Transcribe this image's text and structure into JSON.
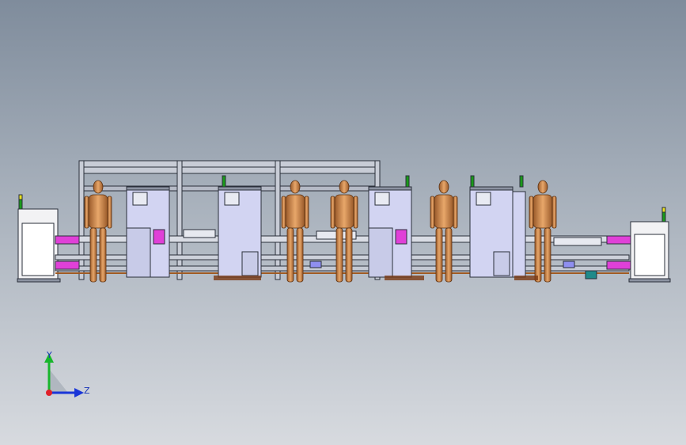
{
  "viewport": {
    "background_top": "#7f8c9c",
    "background_bottom": "#d7dadf"
  },
  "model": {
    "workers": 6,
    "machine_stations": 4,
    "frame_color": "#c7ccd6",
    "panel_color": "#d2d4f2",
    "pink_accent": "#e040d8",
    "human_color": "#d88a4b"
  },
  "triad": {
    "y_label": "Y",
    "z_label": "Z",
    "x_color": "#e0202a",
    "y_color": "#18b62c",
    "z_color": "#1a36d8"
  }
}
